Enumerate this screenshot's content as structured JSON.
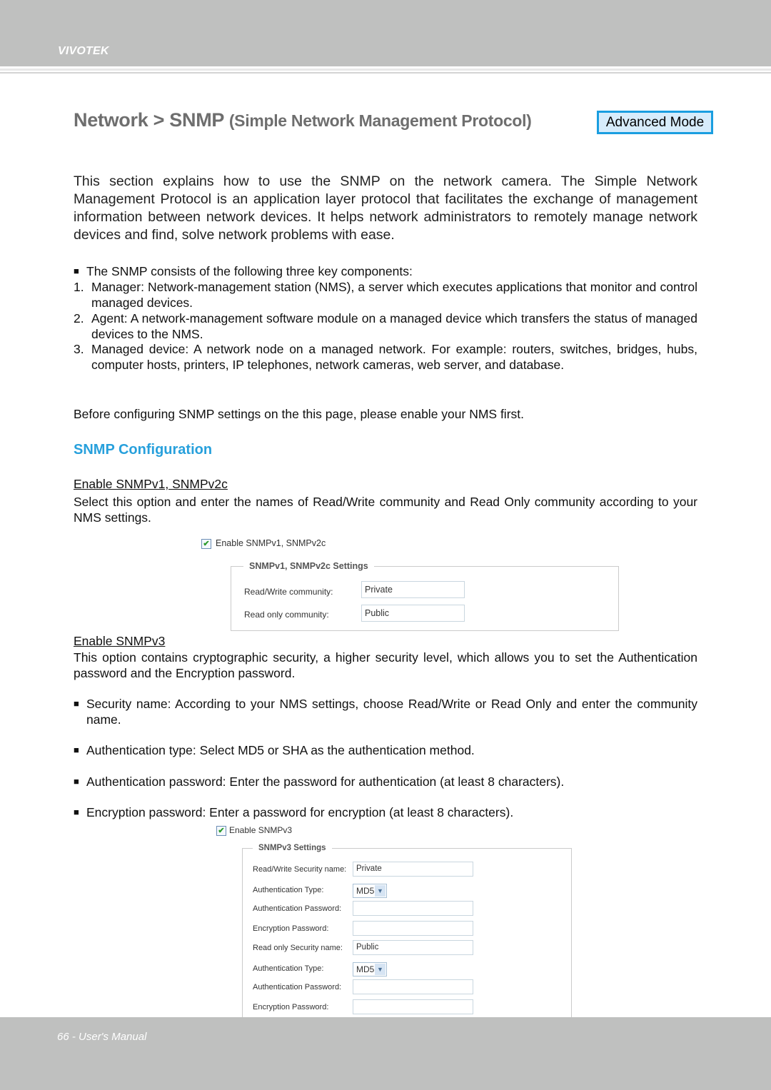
{
  "header": {
    "brand": "VIVOTEK"
  },
  "title": {
    "main": "Network > SNMP",
    "sub": "(Simple Network Management Protocol)",
    "mode_button": "Advanced Mode"
  },
  "intro": "This section explains how to use the SNMP on the network camera. The Simple Network Management Protocol is an application layer protocol that facilitates the exchange of management information between network devices. It helps network administrators to remotely manage network devices and find, solve network problems with ease.",
  "components": {
    "lead": "The SNMP consists of the following three key components:",
    "items": [
      {
        "num": "1.",
        "text": "Manager: Network-management station (NMS), a server which executes applications that monitor and control managed devices."
      },
      {
        "num": "2.",
        "text": "Agent: A network-management software module on a managed device which transfers the status of managed devices to the NMS."
      },
      {
        "num": "3.",
        "text": "Managed device: A network node on a managed network. For example: routers, switches, bridges, hubs, computer hosts, printers, IP telephones, network cameras, web server, and database."
      }
    ]
  },
  "before_note": "Before configuring SNMP settings on the this page, please enable your NMS first.",
  "section_title": "SNMP Configuration",
  "v1v2": {
    "heading": "Enable SNMPv1, SNMPv2c",
    "desc": "Select this option and enter the names of Read/Write community and Read Only community according to your NMS settings.",
    "ui": {
      "checkbox_label": "Enable SNMPv1, SNMPv2c",
      "checked": true,
      "legend": "SNMPv1, SNMPv2c Settings",
      "rw_label": "Read/Write community:",
      "rw_value": "Private",
      "ro_label": "Read only community:",
      "ro_value": "Public"
    }
  },
  "v3": {
    "heading": "Enable SNMPv3",
    "desc": "This option contains cryptographic security, a higher security level, which allows you to set the Authentication password and the Encryption password.",
    "bullets": [
      "Security name: According to your NMS settings, choose Read/Write or Read Only and enter the community name.",
      "Authentication type: Select MD5 or SHA as the authentication method.",
      "Authentication password: Enter the password for authentication (at least 8 characters).",
      "Encryption password: Enter a password for encryption (at least 8 characters)."
    ],
    "ui": {
      "checkbox_label": "Enable SNMPv3",
      "checked": true,
      "legend": "SNMPv3 Settings",
      "rows": [
        {
          "label": "Read/Write Security name:",
          "type": "text",
          "value": "Private"
        },
        {
          "label": "Authentication Type:",
          "type": "select",
          "value": "MD5"
        },
        {
          "label": "Authentication Password:",
          "type": "text",
          "value": ""
        },
        {
          "label": "Encryption Password:",
          "type": "text",
          "value": ""
        },
        {
          "label": "Read only Security name:",
          "type": "text",
          "value": "Public"
        },
        {
          "label": "Authentication Type:",
          "type": "select",
          "value": "MD5"
        },
        {
          "label": "Authentication Password:",
          "type": "text",
          "value": ""
        },
        {
          "label": "Encryption Password:",
          "type": "text",
          "value": ""
        }
      ]
    }
  },
  "footer": {
    "page_label": "66 - User's Manual"
  },
  "icons": {
    "bullet": "black-square-bullet",
    "check": "checkmark",
    "select_arrow": "chevron-down"
  },
  "colors": {
    "accent": "#27a0dc",
    "advanced_border": "#1a9ee0",
    "band": "#bfc0bf"
  }
}
